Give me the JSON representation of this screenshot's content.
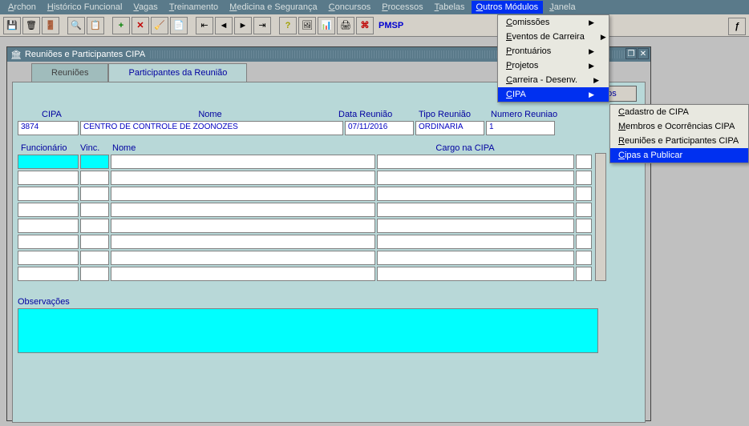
{
  "menubar": {
    "items": [
      {
        "label": "Archon",
        "u": "A",
        "rest": "rchon"
      },
      {
        "label": "Histórico Funcional",
        "u": "H",
        "rest": "istórico Funcional"
      },
      {
        "label": "Vagas",
        "u": "V",
        "rest": "agas"
      },
      {
        "label": "Treinamento",
        "u": "T",
        "rest": "reinamento"
      },
      {
        "label": "Medicina e Segurança",
        "u": "M",
        "rest": "edicina e Segurança"
      },
      {
        "label": "Concursos",
        "u": "C",
        "rest": "oncursos"
      },
      {
        "label": "Processos",
        "u": "P",
        "rest": "rocessos"
      },
      {
        "label": "Tabelas",
        "u": "T",
        "rest": "abelas"
      },
      {
        "label": "Outros Módulos",
        "u": "O",
        "rest": "utros Módulos",
        "active": true
      },
      {
        "label": "Janela",
        "u": "J",
        "rest": "anela"
      }
    ]
  },
  "toolbar": {
    "brand": "PMSP"
  },
  "window": {
    "title": "Reuniões e Participantes CIPA"
  },
  "tabs": {
    "t1": "Reuniões",
    "t2": "Participantes da Reunião"
  },
  "buttons": {
    "inserir": "Inserir todos Membros"
  },
  "headers": {
    "cipa": "CIPA",
    "nome": "Nome",
    "data": "Data Reunião",
    "tipo": "Tipo Reunião",
    "numero": "Numero Reuniao",
    "func": "Funcionário",
    "vinc": "Vinc.",
    "nome2": "Nome",
    "cargo": "Cargo na CIPA",
    "obs": "Observações"
  },
  "record": {
    "cipa": "3874",
    "nome": "CENTRO DE CONTROLE DE ZOONOZES",
    "data": "07/11/2016",
    "tipo": "ORDINARIA",
    "numero": "1"
  },
  "dropdown1": {
    "items": [
      {
        "label": "Comissões",
        "arrow": true
      },
      {
        "label": "Eventos de Carreira",
        "arrow": true
      },
      {
        "label": "Prontuários",
        "arrow": true
      },
      {
        "label": "Projetos",
        "arrow": true
      },
      {
        "label": "Carreira - Desenv.",
        "arrow": true
      },
      {
        "label": "CIPA",
        "arrow": true,
        "highlight": true
      }
    ]
  },
  "dropdown2": {
    "items": [
      {
        "label": "Cadastro de CIPA"
      },
      {
        "label": "Membros e Ocorrências CIPA"
      },
      {
        "label": "Reuniões e Participantes CIPA"
      },
      {
        "label": "Cipas a Publicar",
        "highlight": true
      }
    ]
  }
}
